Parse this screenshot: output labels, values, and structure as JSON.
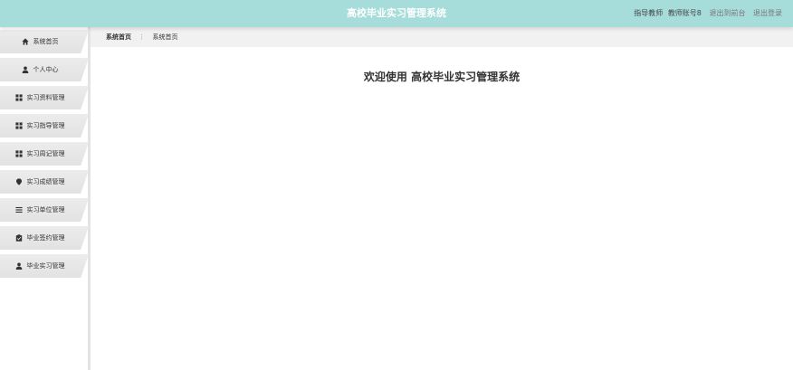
{
  "header": {
    "title": "高校毕业实习管理系统",
    "user_role": "指导教师",
    "user_name": "教师账号8",
    "back_link": "退出到前台",
    "logout_link": "退出登录",
    "bg_color": "#a6dcda"
  },
  "sidebar": {
    "items": [
      {
        "label": "系统首页",
        "icon": "home-icon"
      },
      {
        "label": "个人中心",
        "icon": "user-icon"
      },
      {
        "label": "实习资料管理",
        "icon": "grid-icon"
      },
      {
        "label": "实习指导管理",
        "icon": "grid-icon"
      },
      {
        "label": "实习周记管理",
        "icon": "grid-icon"
      },
      {
        "label": "实习成绩管理",
        "icon": "pin-icon"
      },
      {
        "label": "实习单位管理",
        "icon": "list-icon"
      },
      {
        "label": "毕业签约管理",
        "icon": "clipboard-icon"
      },
      {
        "label": "毕业实习管理",
        "icon": "user-icon"
      }
    ]
  },
  "breadcrumb": {
    "first": "系统首页",
    "separator": "⋮",
    "current": "系统首页"
  },
  "main": {
    "welcome": "欢迎使用 高校毕业实习管理系统"
  }
}
